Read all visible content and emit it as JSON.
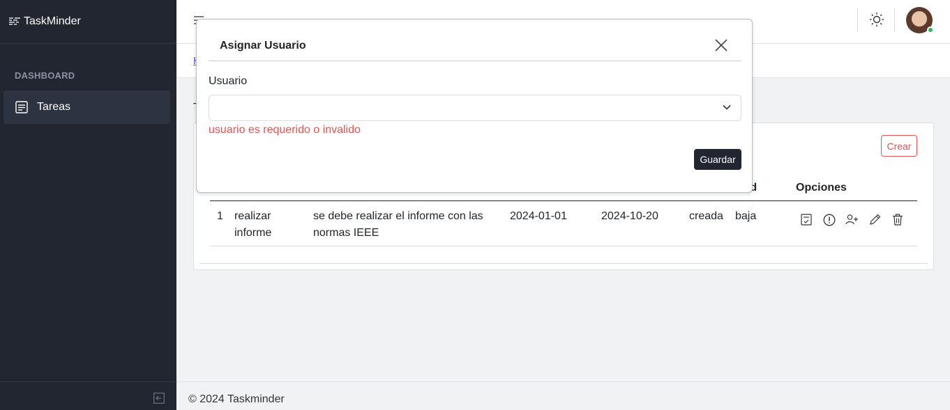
{
  "app": {
    "brand": "TaskMinder"
  },
  "sidebar": {
    "section_title": "DASHBOARD",
    "items": [
      {
        "label": "Tareas",
        "icon": "list-icon"
      }
    ]
  },
  "header": {
    "breadcrumb_home": "H"
  },
  "page": {
    "heading_initial": "T"
  },
  "card": {
    "create_label": "Crear",
    "columns": [
      "ridad",
      "Opciones"
    ],
    "rows": [
      {
        "id": "1",
        "title": "realizar informe",
        "description": "se debe realizar el informe con las normas IEEE",
        "start": "2024-01-01",
        "end": "2024-10-20",
        "state": "creada",
        "priority": "baja"
      }
    ],
    "option_icons": [
      "checklist-icon",
      "alert-icon",
      "add-user-icon",
      "edit-icon",
      "trash-icon"
    ]
  },
  "footer": {
    "text": "© 2024 Taskminder"
  },
  "modal": {
    "title": "Asignar Usuario",
    "field_label": "Usuario",
    "select_value": "",
    "error": "usuario es requerido o invalido",
    "save_label": "Guardar"
  },
  "colors": {
    "sidebar_bg": "#212631",
    "error": "#e55353",
    "primary_dark": "#212631"
  }
}
